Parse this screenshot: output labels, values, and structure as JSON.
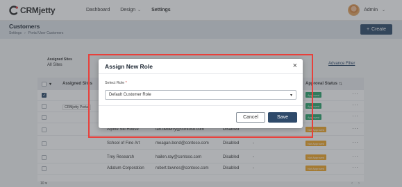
{
  "brand": {
    "name": "CRMjetty"
  },
  "nav": {
    "dashboard": "Dashboard",
    "design": "Design",
    "settings": "Settings"
  },
  "user": {
    "name": "Admin"
  },
  "header": {
    "title": "Customers",
    "breadcrumb": [
      "Settings",
      "Portal User Customers"
    ],
    "create_label": "Create"
  },
  "filter": {
    "label": "Assigned Sites",
    "value": "All Sites",
    "advanced_label": "Advance Filter"
  },
  "table": {
    "headers": {
      "assigned_sites": "Assigned Sites",
      "approval_status": "Approval Status"
    },
    "partial_row_site": "CRMjetty Portal",
    "rows": [
      {
        "name": "Alpine Ski House",
        "email": "ian.deberry@contoso.com",
        "status": "Disabled",
        "dash": "",
        "approval": "Not Approved"
      },
      {
        "name": "School of Fine Art",
        "email": "meagan.bond@contoso.com",
        "status": "Disabled",
        "dash": "-",
        "approval": "Not Approved"
      },
      {
        "name": "Trey Research",
        "email": "hailen.ray@contoso.com",
        "status": "Disabled",
        "dash": "-",
        "approval": "Not Approved"
      },
      {
        "name": "Adatum Corporation",
        "email": "robert.townes@contoso.com",
        "status": "Disabled",
        "dash": "-",
        "approval": "Not Approved"
      }
    ],
    "top_badges": [
      "Approved",
      "Approved",
      "Approved",
      "Not Approved"
    ],
    "pager": "10"
  },
  "modal": {
    "title": "Assign New Role",
    "close": "×",
    "role_label": "Select Role",
    "required_mark": "*",
    "role_value": "Default Customer Role",
    "cancel_label": "Cancel",
    "save_label": "Save"
  },
  "colors": {
    "primary": "#2e4a6a",
    "highlight": "#e8403b",
    "approved": "#2aa46b",
    "not_approved": "#f0a526"
  }
}
